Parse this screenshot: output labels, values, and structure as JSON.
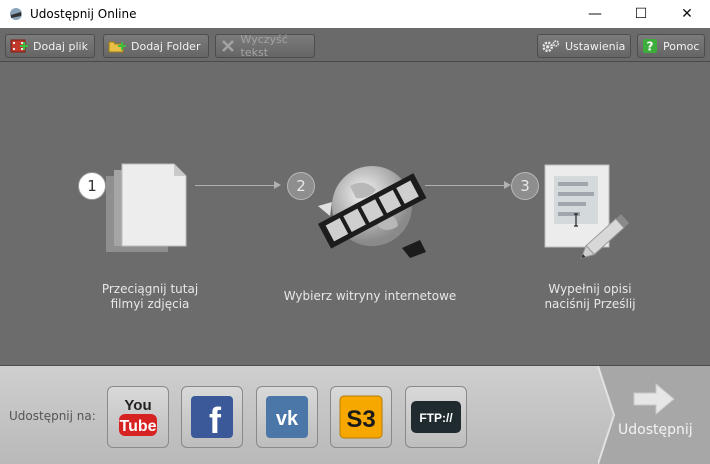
{
  "window": {
    "title": "Udostępnij Online",
    "minimize_glyph": "—",
    "maximize_glyph": "☐",
    "close_glyph": "✕"
  },
  "toolbar": {
    "add_file": "Dodaj plik",
    "add_folder": "Dodaj Folder",
    "clear_text": "Wyczyść tekst",
    "settings": "Ustawienia",
    "help": "Pomoc"
  },
  "steps": [
    {
      "number": "1",
      "label_line1": "Przeciągnij tutaj",
      "label_line2": "filmyi zdjęcia"
    },
    {
      "number": "2",
      "label_line1": "Wybierz witryny internetowe",
      "label_line2": ""
    },
    {
      "number": "3",
      "label_line1": "Wypełnij opisi",
      "label_line2": "naciśnij Prześlij"
    }
  ],
  "share": {
    "label": "Udostępnij na:",
    "sites": [
      {
        "name": "YouTube",
        "text_top": "You",
        "text_bottom": "Tube"
      },
      {
        "name": "Facebook",
        "text": "f"
      },
      {
        "name": "VK",
        "text": "vk"
      },
      {
        "name": "Amazon S3",
        "text": "S3"
      },
      {
        "name": "FTP",
        "text": "FTP://"
      }
    ],
    "send_label": "Udostępnij"
  },
  "colors": {
    "toolbar_bg": "#6a6a6a",
    "main_bg": "#6c6c6c",
    "bottom_bg": "#c4c4c4",
    "youtube_red": "#d72222",
    "facebook_blue": "#3b5998",
    "vk_blue": "#4a76a8",
    "s3_orange": "#f7a800",
    "ftp_dark": "#1f2b2e"
  }
}
